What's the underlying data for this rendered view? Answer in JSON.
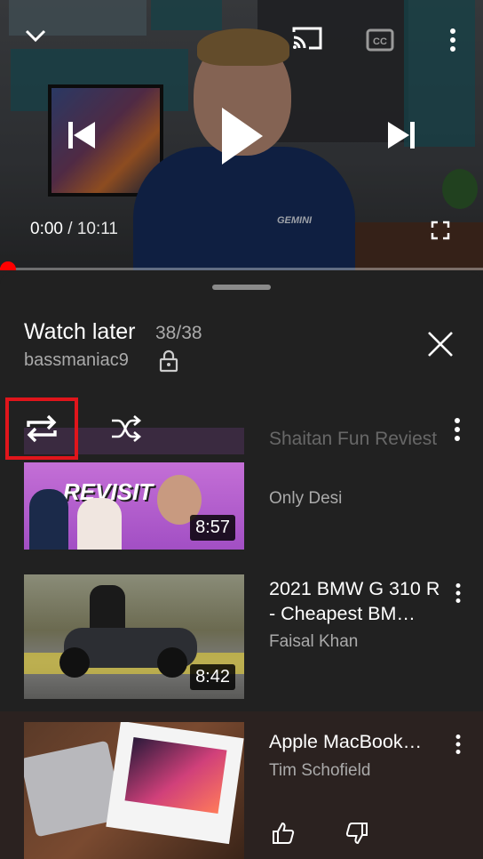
{
  "player": {
    "current_time": "0:00",
    "separator": " / ",
    "duration": "10:11",
    "progress": 0.0,
    "shirt_logo": "GEMINI",
    "accent_color": "#ff0000"
  },
  "playlist": {
    "title": "Watch later",
    "count": "38/38",
    "owner": "bassmaniac9",
    "privacy_icon": "lock-icon",
    "loop_highlight_color": "#e0151b"
  },
  "videos": [
    {
      "title_partial": "Shaitan Fun Reviest",
      "thumb_overlay": "REVISIT",
      "channel": "Only Desi",
      "duration": "8:57"
    },
    {
      "title": "2021 BMW G 310 R - Cheapest BM…",
      "channel": "Faisal Khan",
      "duration": "8:42"
    },
    {
      "title": "Apple MacBook…",
      "channel": "Tim Schofield"
    }
  ]
}
